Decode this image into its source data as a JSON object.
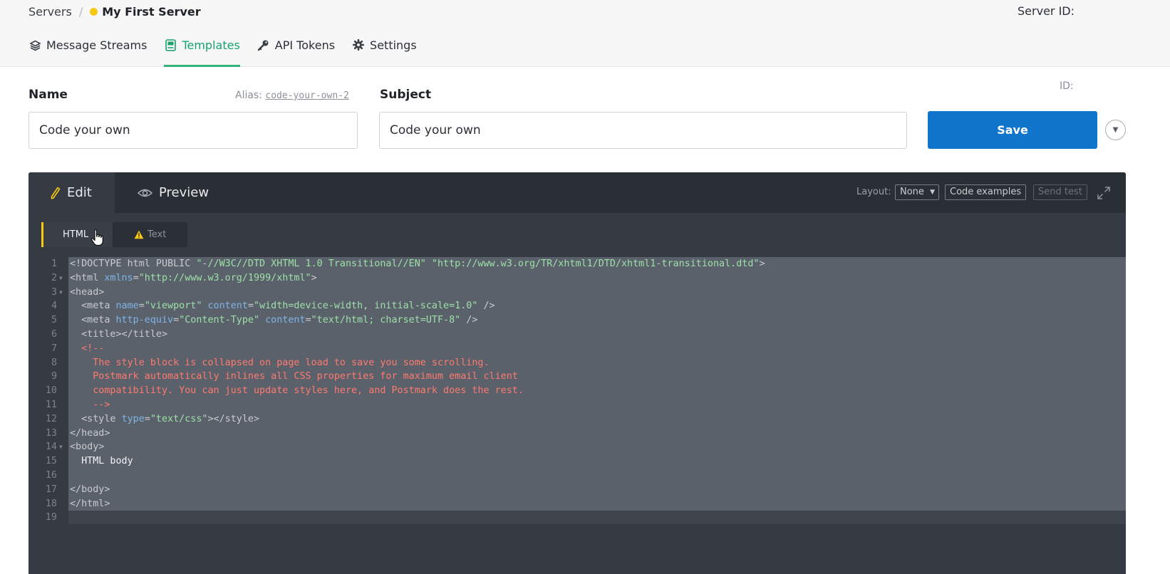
{
  "breadcrumb": {
    "root": "Servers",
    "separator": "/",
    "server_name": "My First Server",
    "status_color": "#f6c915"
  },
  "header": {
    "server_id_label": "Server ID:"
  },
  "nav_tabs": [
    {
      "label": "Message Streams",
      "icon": "layers-icon",
      "active": false
    },
    {
      "label": "Templates",
      "icon": "template-icon",
      "active": true
    },
    {
      "label": "API Tokens",
      "icon": "key-icon",
      "active": false
    },
    {
      "label": "Settings",
      "icon": "gear-icon",
      "active": false
    }
  ],
  "form": {
    "name_label": "Name",
    "alias_label": "Alias:",
    "alias_value": "code-your-own-2",
    "name_value": "Code your own",
    "subject_label": "Subject",
    "subject_value": "Code your own",
    "id_label": "ID:",
    "save_label": "Save"
  },
  "editor": {
    "tabs": {
      "edit": "Edit",
      "preview": "Preview"
    },
    "layout_label": "Layout:",
    "layout_value": "None",
    "code_examples": "Code examples",
    "send_test": "Send test",
    "subtabs": {
      "html": "HTML",
      "text": "Text"
    },
    "code_lines": [
      [
        [
          "c-tag",
          "<!DOCTYPE html PUBLIC "
        ],
        [
          "c-str",
          "\"-//W3C//DTD XHTML 1.0 Transitional//EN\""
        ],
        [
          "c-tag",
          " "
        ],
        [
          "c-str",
          "\"http://www.w3.org/TR/xhtml1/DTD/xhtml1-transitional.dtd\""
        ],
        [
          "c-tag",
          ">"
        ]
      ],
      [
        [
          "c-tag",
          "<html "
        ],
        [
          "c-attr",
          "xmlns"
        ],
        [
          "c-tag",
          "="
        ],
        [
          "c-str",
          "\"http://www.w3.org/1999/xhtml\""
        ],
        [
          "c-tag",
          ">"
        ]
      ],
      [
        [
          "c-tag",
          "<head>"
        ]
      ],
      [
        [
          "c-tag",
          "  <meta "
        ],
        [
          "c-attr",
          "name"
        ],
        [
          "c-tag",
          "="
        ],
        [
          "c-str",
          "\"viewport\""
        ],
        [
          "c-tag",
          " "
        ],
        [
          "c-attr",
          "content"
        ],
        [
          "c-tag",
          "="
        ],
        [
          "c-str",
          "\"width=device-width, initial-scale=1.0\""
        ],
        [
          "c-tag",
          " />"
        ]
      ],
      [
        [
          "c-tag",
          "  <meta "
        ],
        [
          "c-attr",
          "http-equiv"
        ],
        [
          "c-tag",
          "="
        ],
        [
          "c-str",
          "\"Content-Type\""
        ],
        [
          "c-tag",
          " "
        ],
        [
          "c-attr",
          "content"
        ],
        [
          "c-tag",
          "="
        ],
        [
          "c-str",
          "\"text/html; charset=UTF-8\""
        ],
        [
          "c-tag",
          " />"
        ]
      ],
      [
        [
          "c-tag",
          "  <title></title>"
        ]
      ],
      [
        [
          "c-cmt",
          "  <!--"
        ]
      ],
      [
        [
          "c-cmt",
          "    The style block is collapsed on page load to save you some scrolling."
        ]
      ],
      [
        [
          "c-cmt",
          "    Postmark automatically inlines all CSS properties for maximum email client"
        ]
      ],
      [
        [
          "c-cmt",
          "    compatibility. You can just update styles here, and Postmark does the rest."
        ]
      ],
      [
        [
          "c-cmt",
          "    -->"
        ]
      ],
      [
        [
          "c-tag",
          "  <style "
        ],
        [
          "c-attr",
          "type"
        ],
        [
          "c-tag",
          "="
        ],
        [
          "c-str",
          "\"text/css\""
        ],
        [
          "c-tag",
          "></style>"
        ]
      ],
      [
        [
          "c-tag",
          "</head>"
        ]
      ],
      [
        [
          "c-tag",
          "<body>"
        ]
      ],
      [
        [
          "c-plain",
          "  HTML body"
        ]
      ],
      [
        [
          "c-plain",
          ""
        ]
      ],
      [
        [
          "c-tag",
          "</body>"
        ]
      ],
      [
        [
          "c-tag",
          "</html>"
        ]
      ],
      [
        [
          "c-plain",
          ""
        ]
      ]
    ],
    "line_numbers": [
      "1",
      "2",
      "3",
      "4",
      "5",
      "6",
      "7",
      "8",
      "9",
      "10",
      "11",
      "12",
      "13",
      "14",
      "15",
      "16",
      "17",
      "18",
      "19"
    ],
    "fold_lines": [
      2,
      3,
      14
    ]
  }
}
